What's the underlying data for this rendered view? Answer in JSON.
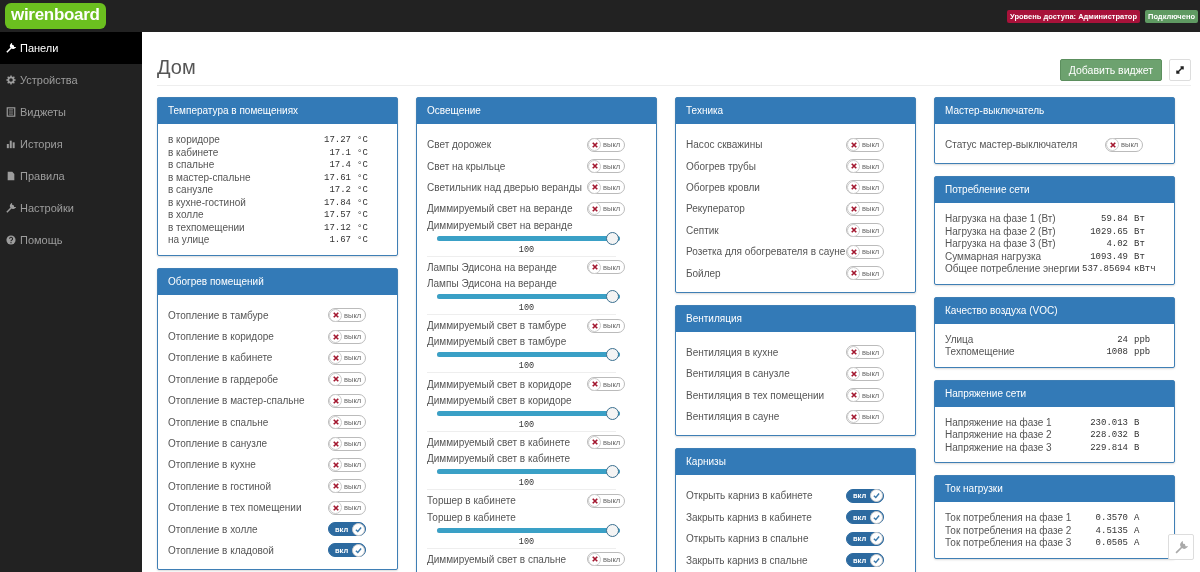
{
  "topbar": {
    "logo": "wirenboard",
    "badges": [
      {
        "text": "Уровень доступа: Администратор",
        "kind": "danger"
      },
      {
        "text": "Подключено",
        "kind": "success"
      }
    ]
  },
  "sidebar": {
    "items": [
      {
        "label": "Панели",
        "selected": true
      },
      {
        "label": "Устройства",
        "selected": false
      },
      {
        "label": "Виджеты",
        "selected": false
      },
      {
        "label": "История",
        "selected": false
      },
      {
        "label": "Правила",
        "selected": false
      },
      {
        "label": "Настройки",
        "selected": false
      },
      {
        "label": "Помощь",
        "selected": false
      }
    ]
  },
  "page": {
    "title": "Дом",
    "add_button": "Добавить виджет"
  },
  "columns": [
    {
      "widgets": [
        {
          "title": "Температура в помещениях",
          "rows": [
            {
              "kind": "value",
              "label": "в коридоре",
              "value": "17.27",
              "unit": "°C"
            },
            {
              "kind": "value",
              "label": "в кабинете",
              "value": "17.1",
              "unit": "°C"
            },
            {
              "kind": "value",
              "label": "в спальне",
              "value": "17.4",
              "unit": "°C"
            },
            {
              "kind": "value",
              "label": "в мастер-спальне",
              "value": "17.61",
              "unit": "°C"
            },
            {
              "kind": "value",
              "label": "в санузле",
              "value": "17.2",
              "unit": "°C"
            },
            {
              "kind": "value",
              "label": "в кухне-гостиной",
              "value": "17.84",
              "unit": "°C"
            },
            {
              "kind": "value",
              "label": "в холле",
              "value": "17.57",
              "unit": "°C"
            },
            {
              "kind": "value",
              "label": "в техпомещении",
              "value": "17.12",
              "unit": "°C"
            },
            {
              "kind": "value",
              "label": "на улице",
              "value": "1.67",
              "unit": "°C"
            }
          ]
        },
        {
          "title": "Обогрев помещений",
          "rows": [
            {
              "kind": "switch",
              "label": "Отопление в тамбуре",
              "on": false,
              "switch_text": "выкл"
            },
            {
              "kind": "switch",
              "label": "Отопление в коридоре",
              "on": false,
              "switch_text": "выкл"
            },
            {
              "kind": "switch",
              "label": "Отопление в кабинете",
              "on": false,
              "switch_text": "выкл"
            },
            {
              "kind": "switch",
              "label": "Отопление в гардеробе",
              "on": false,
              "switch_text": "выкл"
            },
            {
              "kind": "switch",
              "label": "Отопление в мастер-спальне",
              "on": false,
              "switch_text": "выкл"
            },
            {
              "kind": "switch",
              "label": "Отопление в спальне",
              "on": false,
              "switch_text": "выкл"
            },
            {
              "kind": "switch",
              "label": "Отопление в санузле",
              "on": false,
              "switch_text": "выкл"
            },
            {
              "kind": "switch",
              "label": "Отопление в кухне",
              "on": false,
              "switch_text": "выкл"
            },
            {
              "kind": "switch",
              "label": "Отопление в гостиной",
              "on": false,
              "switch_text": "выкл"
            },
            {
              "kind": "switch",
              "label": "Отопление в тех помещении",
              "on": false,
              "switch_text": "выкл"
            },
            {
              "kind": "switch",
              "label": "Отопление в холле",
              "on": true,
              "switch_text": "вкл"
            },
            {
              "kind": "switch",
              "label": "Отопление в кладовой",
              "on": true,
              "switch_text": "вкл"
            }
          ]
        }
      ]
    },
    {
      "widgets": [
        {
          "title": "Освещение",
          "rows": [
            {
              "kind": "switch",
              "label": "Свет дорожек",
              "on": false,
              "switch_text": "выкл"
            },
            {
              "kind": "switch",
              "label": "Свет на крыльце",
              "on": false,
              "switch_text": "выкл"
            },
            {
              "kind": "switch",
              "label": "Светильник над дверью веранды",
              "on": false,
              "switch_text": "выкл"
            },
            {
              "kind": "switch",
              "label": "Диммируемый свет на веранде",
              "on": false,
              "switch_text": "выкл"
            },
            {
              "kind": "range",
              "label": "Диммируемый свет на веранде",
              "level": 1,
              "reading": "100"
            },
            {
              "kind": "switch",
              "label": "Лампы Эдисона на веранде",
              "on": false,
              "switch_text": "выкл"
            },
            {
              "kind": "range",
              "label": "Лампы Эдисона на веранде",
              "level": 1,
              "reading": "100"
            },
            {
              "kind": "switch",
              "label": "Диммируемый свет в тамбуре",
              "on": false,
              "switch_text": "выкл"
            },
            {
              "kind": "range",
              "label": "Диммируемый свет в тамбуре",
              "level": 1,
              "reading": "100"
            },
            {
              "kind": "switch",
              "label": "Диммируемый свет в коридоре",
              "on": false,
              "switch_text": "выкл"
            },
            {
              "kind": "range",
              "label": "Диммируемый свет в коридоре",
              "level": 1,
              "reading": "100"
            },
            {
              "kind": "switch",
              "label": "Диммируемый свет в кабинете",
              "on": false,
              "switch_text": "выкл"
            },
            {
              "kind": "range",
              "label": "Диммируемый свет в кабинете",
              "level": 1,
              "reading": "100"
            },
            {
              "kind": "switch",
              "label": "Торшер в кабинете",
              "on": false,
              "switch_text": "выкл"
            },
            {
              "kind": "range",
              "label": "Торшер в кабинете",
              "level": 1,
              "reading": "100"
            },
            {
              "kind": "switch",
              "label": "Диммируемый свет в спальне",
              "on": false,
              "switch_text": "выкл"
            }
          ]
        }
      ]
    },
    {
      "widgets": [
        {
          "title": "Техника",
          "rows": [
            {
              "kind": "switch",
              "label": "Насос скважины",
              "on": false,
              "switch_text": "выкл"
            },
            {
              "kind": "switch",
              "label": "Обогрев трубы",
              "on": false,
              "switch_text": "выкл"
            },
            {
              "kind": "switch",
              "label": "Обогрев кровли",
              "on": false,
              "switch_text": "выкл"
            },
            {
              "kind": "switch",
              "label": "Рекуператор",
              "on": false,
              "switch_text": "выкл"
            },
            {
              "kind": "switch",
              "label": "Септик",
              "on": false,
              "switch_text": "выкл"
            },
            {
              "kind": "switch",
              "label": "Розетка для обогревателя в сауне",
              "on": false,
              "switch_text": "выкл"
            },
            {
              "kind": "switch",
              "label": "Бойлер",
              "on": false,
              "switch_text": "выкл"
            }
          ]
        },
        {
          "title": "Вентиляция",
          "rows": [
            {
              "kind": "switch",
              "label": "Вентиляция в кухне",
              "on": false,
              "switch_text": "выкл"
            },
            {
              "kind": "switch",
              "label": "Вентиляция в санузле",
              "on": false,
              "switch_text": "выкл"
            },
            {
              "kind": "switch",
              "label": "Вентиляция в тех помещении",
              "on": false,
              "switch_text": "выкл"
            },
            {
              "kind": "switch",
              "label": "Вентиляция в сауне",
              "on": false,
              "switch_text": "выкл"
            }
          ]
        },
        {
          "title": "Карнизы",
          "rows": [
            {
              "kind": "switch",
              "label": "Открыть карниз в кабинете",
              "on": true,
              "switch_text": "вкл"
            },
            {
              "kind": "switch",
              "label": "Закрыть карниз в кабинете",
              "on": true,
              "switch_text": "вкл"
            },
            {
              "kind": "switch",
              "label": "Открыть карниз в спальне",
              "on": true,
              "switch_text": "вкл"
            },
            {
              "kind": "switch",
              "label": "Закрыть карниз в спальне",
              "on": true,
              "switch_text": "вкл"
            }
          ]
        }
      ]
    },
    {
      "widgets": [
        {
          "title": "Мастер-выключатель",
          "rows": [
            {
              "kind": "switch",
              "label": "Статус мастер-выключателя",
              "on": false,
              "switch_text": "выкл"
            }
          ]
        },
        {
          "title": "Потребление сети",
          "rows": [
            {
              "kind": "value",
              "label": "Нагрузка на фазе 1 (Вт)",
              "value": "59.84",
              "unit": "Вт"
            },
            {
              "kind": "value",
              "label": "Нагрузка на фазе 2 (Вт)",
              "value": "1029.65",
              "unit": "Вт"
            },
            {
              "kind": "value",
              "label": "Нагрузка на фазе 3 (Вт)",
              "value": "4.02",
              "unit": "Вт"
            },
            {
              "kind": "value",
              "label": "Суммарная нагрузка",
              "value": "1093.49",
              "unit": "Вт"
            },
            {
              "kind": "value",
              "label": "Общее потребление энергии",
              "value": "537.85694",
              "unit": "кВтч"
            }
          ]
        },
        {
          "title": "Качество воздуха (VOC)",
          "rows": [
            {
              "kind": "value",
              "label": "Улица",
              "value": "24",
              "unit": "ppb"
            },
            {
              "kind": "value",
              "label": "Техпомещение",
              "value": "1008",
              "unit": "ppb"
            }
          ]
        },
        {
          "title": "Напряжение сети",
          "rows": [
            {
              "kind": "value",
              "label": "Напряжение на фазе 1",
              "value": "230.013",
              "unit": "В"
            },
            {
              "kind": "value",
              "label": "Напряжение на фазе 2",
              "value": "228.032",
              "unit": "В"
            },
            {
              "kind": "value",
              "label": "Напряжение на фазе 3",
              "value": "229.814",
              "unit": "В"
            }
          ]
        },
        {
          "title": "Ток нагрузки",
          "rows": [
            {
              "kind": "value",
              "label": "Ток потребления на фазе 1",
              "value": "0.3570",
              "unit": "A"
            },
            {
              "kind": "value",
              "label": "Ток потребления на фазе 2",
              "value": "4.5135",
              "unit": "A"
            },
            {
              "kind": "value",
              "label": "Ток потребления на фазе 3",
              "value": "0.0505",
              "unit": "A"
            }
          ]
        }
      ]
    }
  ]
}
